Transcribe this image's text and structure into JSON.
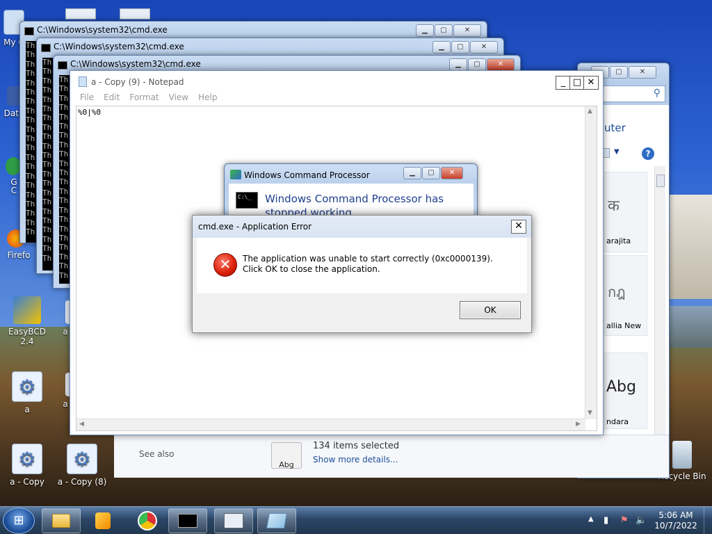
{
  "desktop": {
    "icons": [
      {
        "label": "My C"
      },
      {
        "label": "Data"
      },
      {
        "label": "G\nC"
      },
      {
        "label": "Firefo"
      },
      {
        "label": "EasyBCD 2.4"
      },
      {
        "label": "a"
      },
      {
        "label": "a"
      },
      {
        "label": "a"
      },
      {
        "label": "a - Copy"
      },
      {
        "label": "a - Copy (8)"
      },
      {
        "label": "Recycle Bin"
      }
    ]
  },
  "cmd_windows": [
    {
      "title": "C:\\Windows\\system32\\cmd.exe"
    },
    {
      "title": "C:\\Windows\\system32\\cmd.exe"
    },
    {
      "title": "C:\\Windows\\system32\\cmd.exe"
    }
  ],
  "cmd_line_text": "Th",
  "notepad": {
    "title": "a - Copy (9) - Notepad",
    "menu": [
      "File",
      "Edit",
      "Format",
      "View",
      "Help"
    ],
    "content": "%0|%0"
  },
  "explorer": {
    "partial_title": "uter",
    "fonts": [
      {
        "glyph": "क",
        "label": "arajita"
      },
      {
        "glyph": "กฎ",
        "label": "allia New"
      },
      {
        "glyph": "Abg",
        "label": "ndara"
      }
    ],
    "status": {
      "see_also": "See also",
      "selected": "134 items selected",
      "details_link": "Show more details...",
      "thumb": "Abg"
    }
  },
  "cmd_processor_dialog": {
    "title": "Windows Command Processor",
    "heading": "Windows Command Processor has stopped working"
  },
  "app_error": {
    "title": "cmd.exe - Application Error",
    "message": "The application was unable to start correctly (0xc0000139). Click OK to close the application.",
    "ok_label": "OK"
  },
  "taskbar": {
    "time": "5:06 AM",
    "date": "10/7/2022"
  }
}
